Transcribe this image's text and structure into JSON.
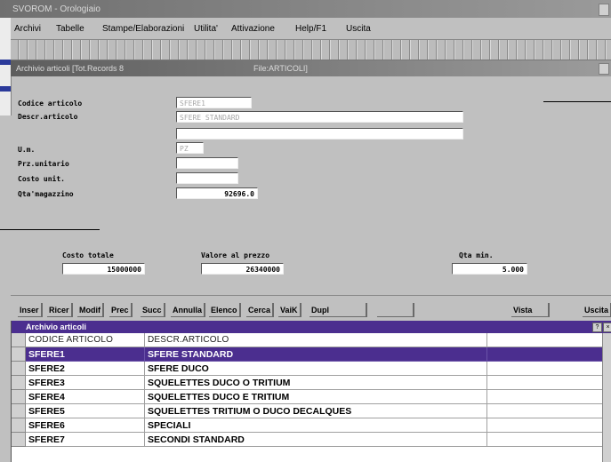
{
  "app": {
    "title": "SVOROM - Orologiaio"
  },
  "menu": [
    "Archivi",
    "Tabelle",
    "Stampe/Elaborazioni",
    "Utilita'",
    "Attivazione",
    "Help/F1",
    "Uscita"
  ],
  "child_window": {
    "title": "Archivio articoli [Tot.Records 8",
    "file": "File:ARTICOLI]"
  },
  "form": {
    "codice_label": "Codice articolo",
    "codice_value": "SFERE1",
    "descr_label": "Descr.articolo",
    "descr_value1": "SFERE STANDARD",
    "descr_value2": "",
    "um_label": "U.m.",
    "um_value": "PZ",
    "prz_label": "Prz.unitario",
    "prz_value": "",
    "costo_label": "Costo unit.",
    "costo_value": "",
    "qta_label": "Qta'magazzino",
    "qta_value": "92696.0",
    "costo_totale_label": "Costo totale",
    "costo_totale_value": "15000000",
    "valore_label": "Valore al prezzo",
    "valore_value": "26340000",
    "qta_min_label": "Qta min.",
    "qta_min_value": "5.000"
  },
  "buttons": [
    "Inser",
    "Ricer",
    "Modif",
    "Prec",
    "Succ",
    "Annulla",
    "Elenco",
    "Cerca",
    "VaiK",
    "Dupl",
    "Vista",
    "Uscita"
  ],
  "grid": {
    "title": "Archivio articoli",
    "col_codice": "CODICE ARTICOLO",
    "col_descr": "DESCR.ARTICOLO",
    "rows": [
      {
        "codice": "SFERE1",
        "descr": "SFERE STANDARD"
      },
      {
        "codice": "SFERE2",
        "descr": "SFERE DUCO"
      },
      {
        "codice": "SFERE3",
        "descr": "SQUELETTES DUCO O TRITIUM"
      },
      {
        "codice": "SFERE4",
        "descr": "SQUELETTES DUCO E TRITIUM"
      },
      {
        "codice": "SFERE5",
        "descr": "SQUELETTES TRITIUM O DUCO DECALQUES"
      },
      {
        "codice": "SFERE6",
        "descr": "SPECIALI"
      },
      {
        "codice": "SFERE7",
        "descr": "SECONDI STANDARD"
      }
    ]
  },
  "colors": {
    "selection": "#4b2e8f",
    "background": "#c0c0c0"
  }
}
